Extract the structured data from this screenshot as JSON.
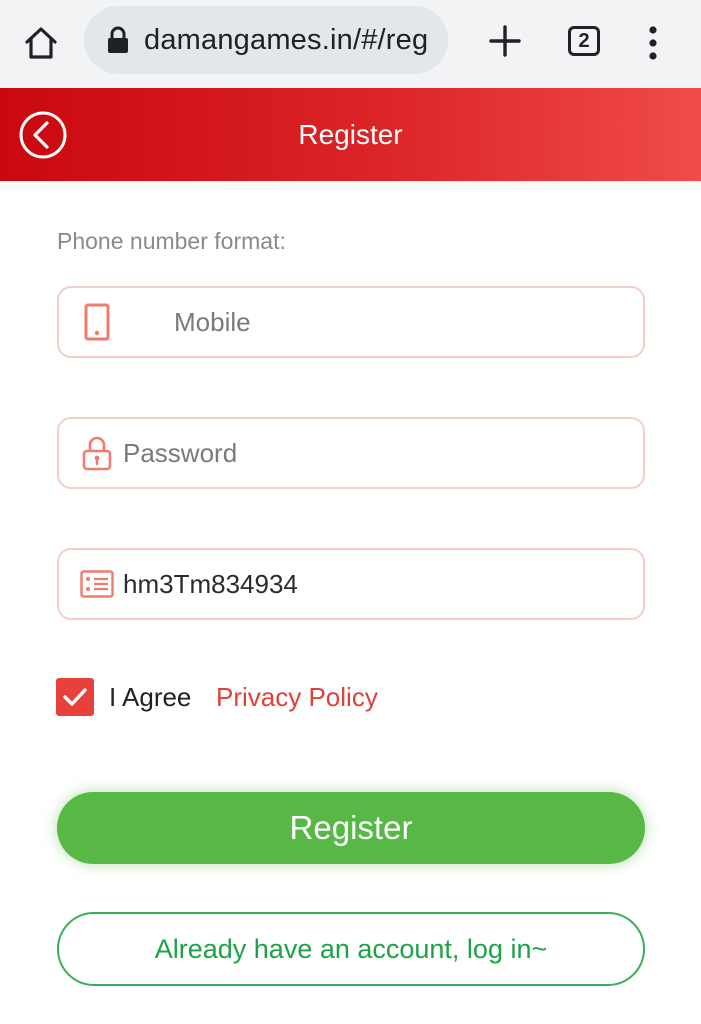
{
  "browser": {
    "url": "damangames.in/#/reg",
    "tab_count": "2",
    "icons": {
      "home": "home-icon",
      "lock": "lock-icon",
      "new_tab": "plus-icon",
      "tabs": "tab-switcher-icon",
      "menu": "kebab-menu-icon"
    }
  },
  "header": {
    "title": "Register",
    "back_icon": "circle-chevron-left-icon",
    "colors": {
      "start": "#c9080f",
      "end": "#f04b4a"
    }
  },
  "form": {
    "phone_format_label": "Phone number format:",
    "mobile": {
      "placeholder": "Mobile",
      "value": "",
      "icon": "mobile-phone-icon"
    },
    "password": {
      "placeholder": "Password",
      "value": "",
      "icon": "padlock-icon"
    },
    "invite_code": {
      "placeholder": "",
      "value": "hm3Tm834934",
      "icon": "id-card-icon"
    },
    "agree": {
      "checked": true,
      "label": "I Agree",
      "link": "Privacy Policy"
    },
    "register_button": "Register",
    "login_button": "Already have an account, log in~"
  },
  "colors": {
    "accent_red": "#e0403a",
    "field_border": "#f4cfc9",
    "register_green": "#58b845",
    "login_green": "#1da24a"
  }
}
